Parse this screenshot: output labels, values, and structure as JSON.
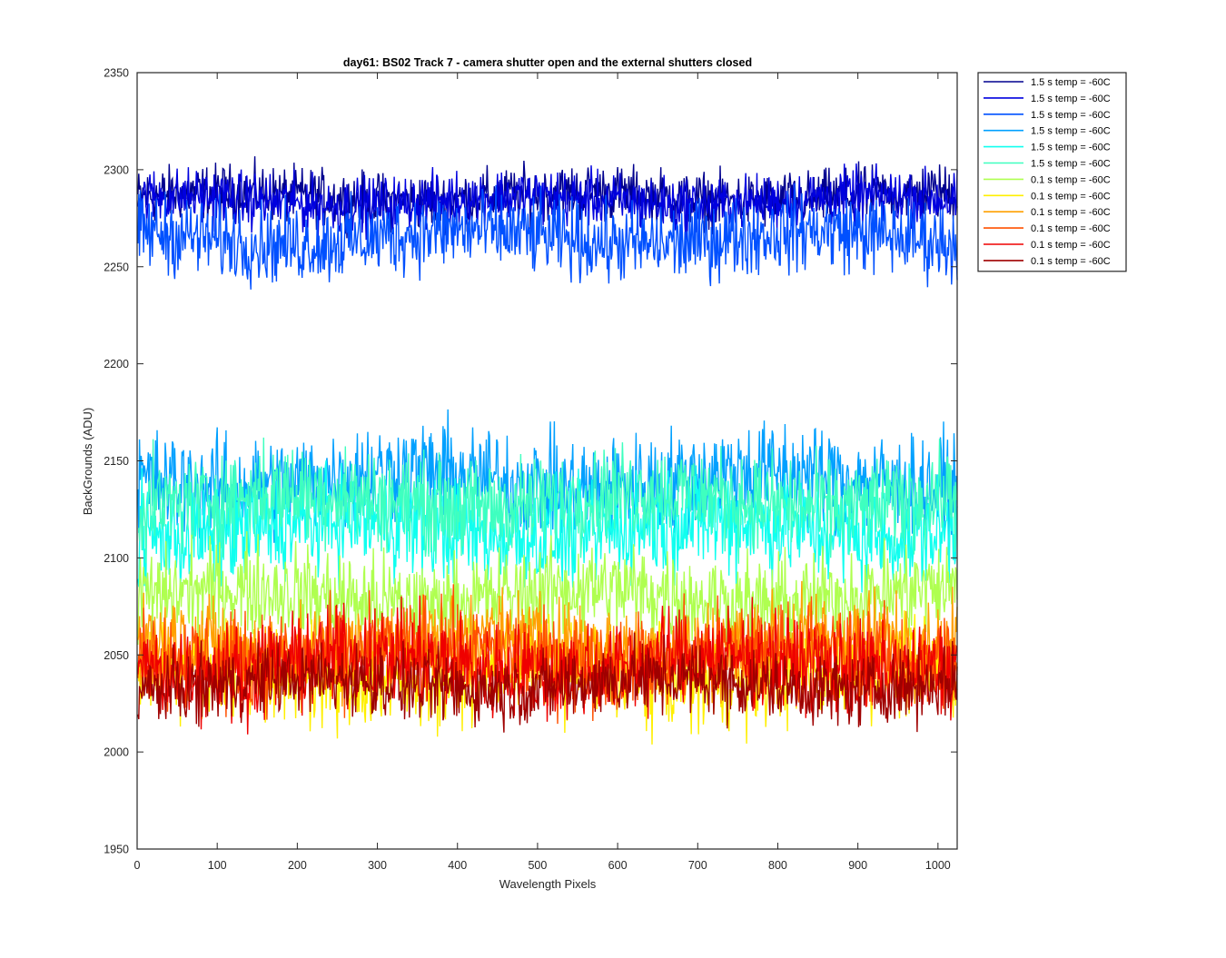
{
  "chart_data": {
    "type": "line",
    "title": "day61: BS02  Track 7 - camera shutter open and the external shutters closed",
    "xlabel": "Wavelength Pixels",
    "ylabel": "BackGrounds (ADU)",
    "xlim": [
      0,
      1024
    ],
    "ylim": [
      1950,
      2350
    ],
    "xticks": [
      0,
      100,
      200,
      300,
      400,
      500,
      600,
      700,
      800,
      900,
      1000
    ],
    "yticks": [
      1950,
      2000,
      2050,
      2100,
      2150,
      2200,
      2250,
      2300,
      2350
    ],
    "grid": false,
    "legend_position": "outside-top-right",
    "series": [
      {
        "name": "1.5 s temp = -60C",
        "color": "#00008f",
        "mean": 2286,
        "spread": 7
      },
      {
        "name": "1.5 s temp = -60C",
        "color": "#0000df",
        "mean": 2284,
        "spread": 7
      },
      {
        "name": "1.5 s temp = -60C",
        "color": "#0050ff",
        "mean": 2265,
        "spread": 10
      },
      {
        "name": "1.5 s temp = -60C",
        "color": "#00a0ff",
        "mean": 2140,
        "spread": 13
      },
      {
        "name": "1.5 s temp = -60C",
        "color": "#10ffef",
        "mean": 2115,
        "spread": 13
      },
      {
        "name": "1.5 s temp = -60C",
        "color": "#3fffbf",
        "mean": 2130,
        "spread": 12
      },
      {
        "name": "0.1 s temp = -60C",
        "color": "#afff50",
        "mean": 2080,
        "spread": 12
      },
      {
        "name": "0.1 s temp = -60C",
        "color": "#ffef00",
        "mean": 2040,
        "spread": 12
      },
      {
        "name": "0.1 s temp = -60C",
        "color": "#ffa000",
        "mean": 2055,
        "spread": 12
      },
      {
        "name": "0.1 s temp = -60C",
        "color": "#ff5000",
        "mean": 2050,
        "spread": 12
      },
      {
        "name": "0.1 s temp = -60C",
        "color": "#ef0000",
        "mean": 2045,
        "spread": 12
      },
      {
        "name": "0.1 s temp = -60C",
        "color": "#9f0000",
        "mean": 2035,
        "spread": 9
      }
    ]
  }
}
